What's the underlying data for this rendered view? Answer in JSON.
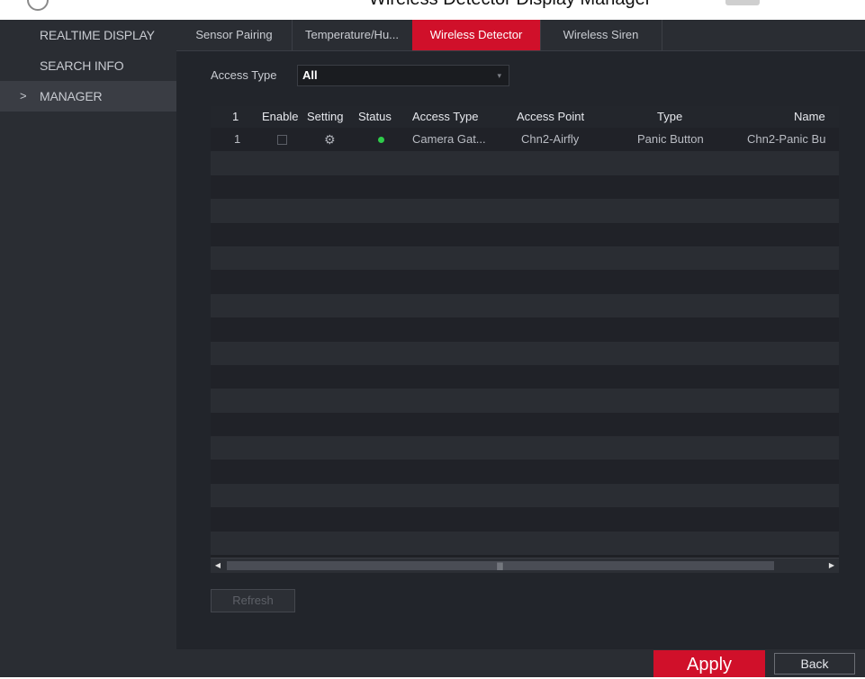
{
  "top_caption": "Wireless Detector Display Manager",
  "sidebar": {
    "items": [
      {
        "label": "REALTIME DISPLAY",
        "active": false
      },
      {
        "label": "SEARCH INFO",
        "active": false
      },
      {
        "label": "MANAGER",
        "active": true,
        "caret": ">"
      }
    ]
  },
  "tabs": [
    {
      "label": "Sensor Pairing"
    },
    {
      "label": "Temperature/Hu..."
    },
    {
      "label": "Wireless Detector",
      "active": true
    },
    {
      "label": "Wireless Siren"
    }
  ],
  "filter": {
    "label": "Access Type",
    "value": "All",
    "arrow": "▾"
  },
  "table": {
    "headers": {
      "index": "1",
      "enable": "Enable",
      "setting": "Setting",
      "status": "Status",
      "access_type": "Access Type",
      "access_point": "Access Point",
      "type": "Type",
      "name": "Name"
    },
    "rows": [
      {
        "index": "1",
        "enabled": false,
        "setting_icon": "gear-icon",
        "status": "online",
        "status_color": "#2ecc4a",
        "access_type": "Camera Gat...",
        "access_point": "Chn2-Airfly",
        "type": "Panic Button",
        "name": "Chn2-Panic Bu"
      }
    ]
  },
  "scrollbar": {
    "left_arrow": "◀",
    "right_arrow": "▶",
    "grip": "|||"
  },
  "buttons": {
    "refresh": "Refresh",
    "apply": "Apply",
    "back": "Back"
  },
  "colors": {
    "accent": "#d0102a",
    "status_online": "#2ecc4a"
  }
}
